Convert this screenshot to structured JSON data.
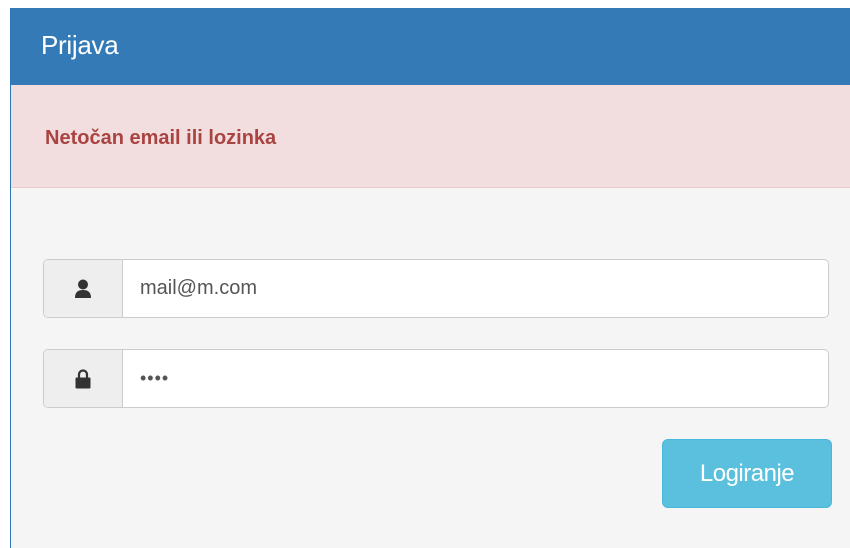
{
  "panel": {
    "title": "Prijava",
    "header_color": "#337ab7"
  },
  "alert": {
    "message": "Netočan email ili lozinka",
    "text_color": "#a94442",
    "background": "#f2dede"
  },
  "form": {
    "email": {
      "icon": "user-icon",
      "value": "mail@m.com"
    },
    "password": {
      "icon": "lock-icon",
      "value": "••••"
    },
    "submit_label": "Logiranje",
    "submit_color": "#5bc0de"
  }
}
